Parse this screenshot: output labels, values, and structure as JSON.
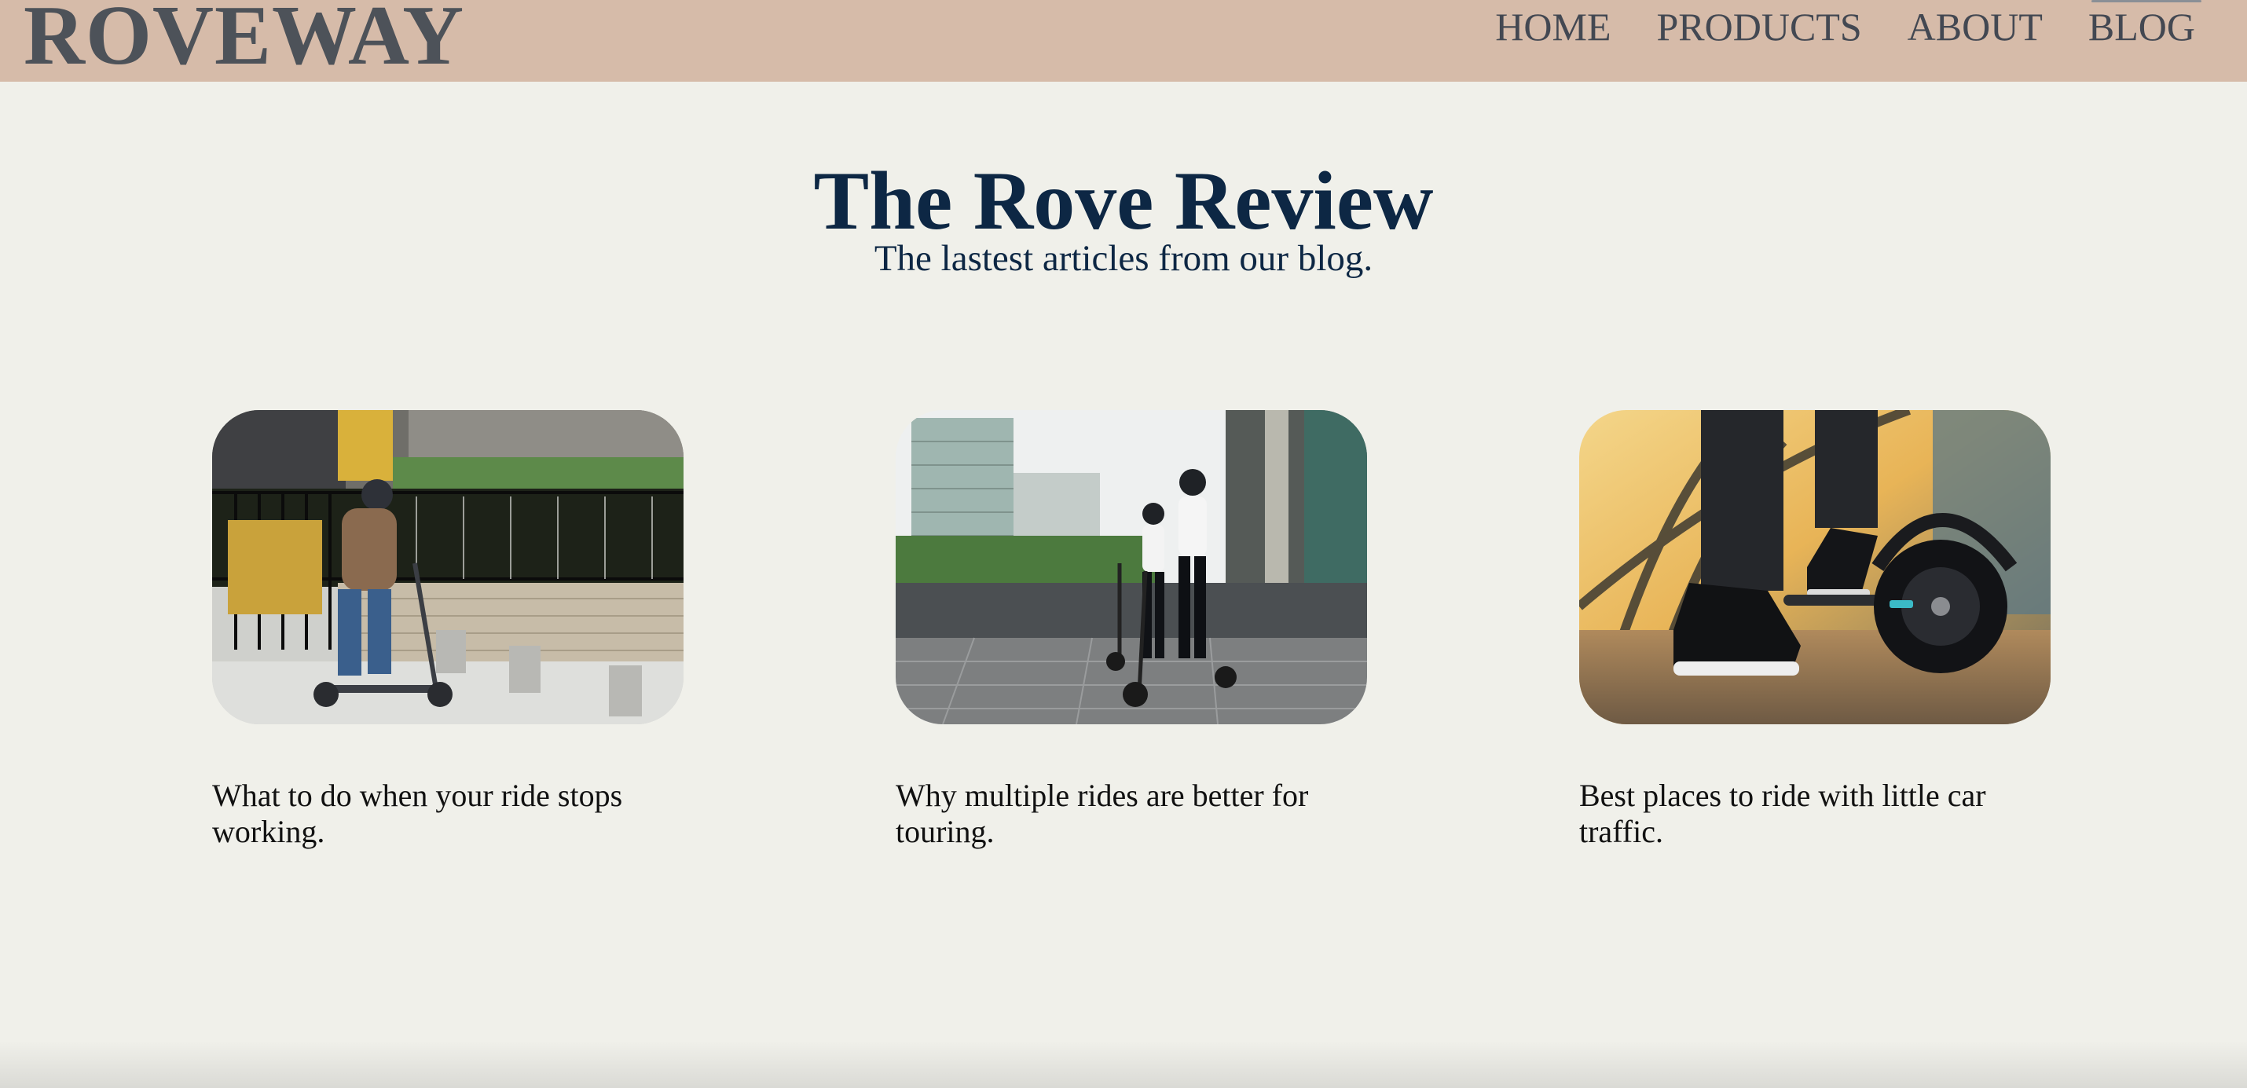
{
  "header": {
    "brand": "ROVEWAY",
    "nav": [
      {
        "label": "HOME"
      },
      {
        "label": "PRODUCTS"
      },
      {
        "label": "ABOUT"
      },
      {
        "label": "BLOG"
      }
    ]
  },
  "hero": {
    "title": "The Rove Review",
    "subtitle": "The lastest articles from our blog."
  },
  "articles": [
    {
      "title": "What to do when your ride stops working."
    },
    {
      "title": "Why multiple rides are better for touring."
    },
    {
      "title": "Best places to ride with little car traffic."
    }
  ],
  "colors": {
    "header_bg": "#d6bba9",
    "page_bg": "#f0f0ea",
    "title_navy": "#0d2744",
    "brand_gray": "#4d5259"
  }
}
